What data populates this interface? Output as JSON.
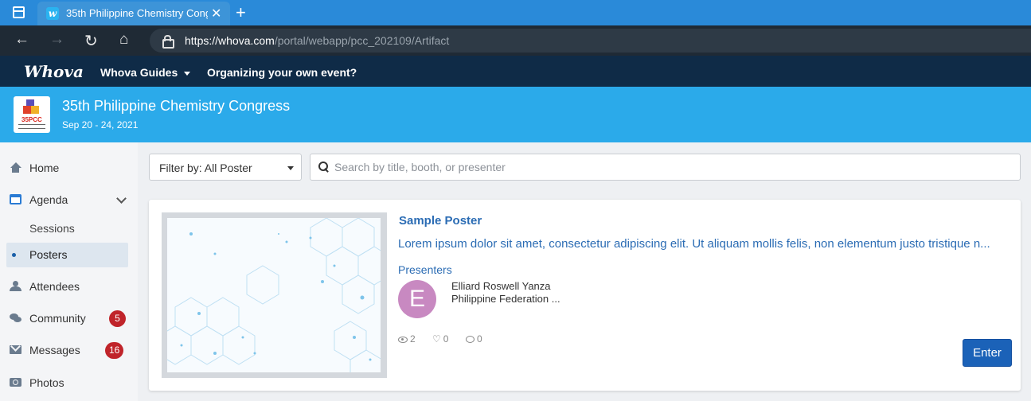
{
  "browser": {
    "tab_title": "35th Philippine Chemistry Congress",
    "tab_favicon_letter": "w",
    "url_host": "https://whova.com",
    "url_path": "/portal/webapp/pcc_202109/Artifact"
  },
  "topnav": {
    "logo": "Whova",
    "guides": "Whova Guides",
    "organize": "Organizing your own event?"
  },
  "event": {
    "logo_text": "35PCC",
    "title": "35th Philippine Chemistry Congress",
    "dates": "Sep 20 - 24, 2021"
  },
  "sidebar": {
    "items": [
      {
        "label": "Home",
        "icon": "home-icon"
      },
      {
        "label": "Agenda",
        "icon": "calendar-icon"
      },
      {
        "label": "Sessions"
      },
      {
        "label": "Posters"
      },
      {
        "label": "Attendees",
        "icon": "people-icon"
      },
      {
        "label": "Community",
        "icon": "chat-icon",
        "badge": "5"
      },
      {
        "label": "Messages",
        "icon": "mail-icon",
        "badge": "16"
      },
      {
        "label": "Photos",
        "icon": "camera-icon"
      }
    ],
    "active": "Posters"
  },
  "filter": {
    "label": "Filter by: All Poster",
    "search_placeholder": "Search by title, booth, or presenter"
  },
  "poster": {
    "title": "Sample Poster",
    "description": "Lorem ipsum dolor sit amet, consectetur adipiscing elit. Ut aliquam mollis felis, non elementum justo tristique n...",
    "presenters_label": "Presenters",
    "presenter": {
      "initial": "E",
      "name": "Elliard Roswell Yanza",
      "org": "Philippine Federation ..."
    },
    "stats": {
      "views": "2",
      "likes": "0",
      "comments": "0"
    },
    "enter_label": "Enter"
  },
  "colors": {
    "accent": "#2baaea",
    "nav": "#0f2b47",
    "link": "#2b6cb4",
    "badge": "#c0242a",
    "avatar": "#c889c1",
    "button": "#1b62b8"
  }
}
